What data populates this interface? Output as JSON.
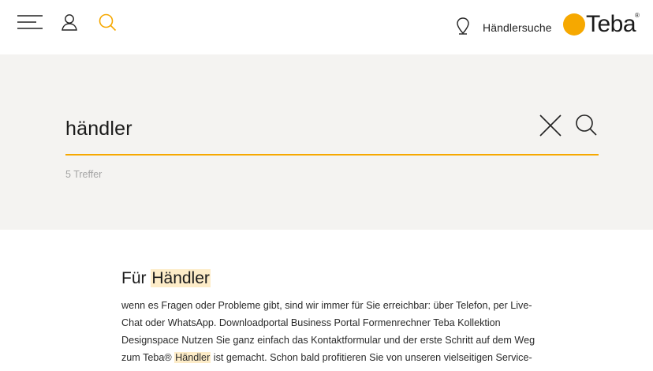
{
  "header": {
    "menu_icon": "menu-icon",
    "user_icon": "user-icon",
    "search_icon": "search-icon",
    "dealer_search_label": "Händlersuche",
    "logo_text": "Teba",
    "logo_reg": "®"
  },
  "colors": {
    "accent": "#f6a800",
    "panel": "#f4f3f1",
    "highlight": "#fdecc8"
  },
  "search": {
    "query": "händler",
    "hits": "5 Treffer"
  },
  "results": [
    {
      "title_prefix": "Für ",
      "title_highlight": "Händler",
      "snippet_1": "wenn es Fragen oder Probleme gibt, sind wir immer für Sie erreichbar: über Telefon, per Live-Chat oder WhatsApp. Downloadportal Business Portal Formenrechner Teba Kollektion Designspace Nutzen Sie ganz einfach das Kontaktformular und der erste Schritt auf dem Weg zum Teba® ",
      "snippet_highlight": "Händler",
      "snippet_2": " ist gemacht. Schon bald profitieren Sie von unseren vielseitigen Service-"
    }
  ]
}
